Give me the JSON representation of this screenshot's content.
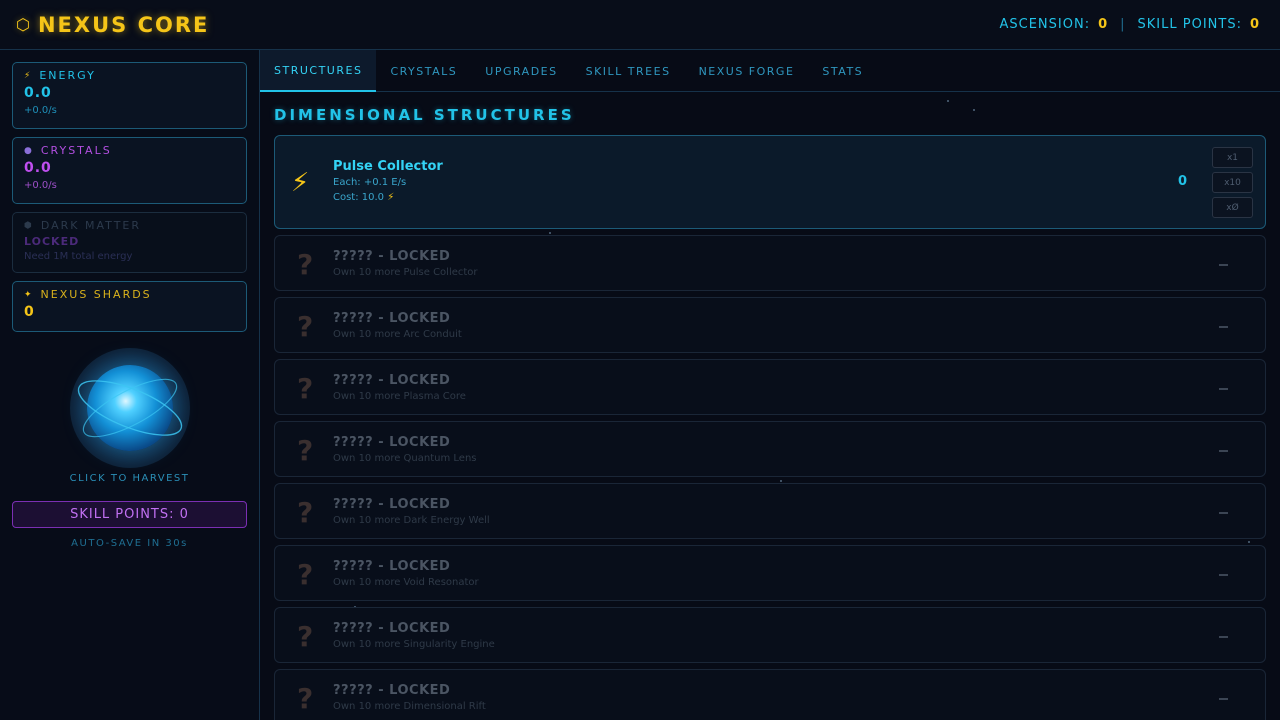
{
  "header": {
    "brand_icon": "hexagon-icon",
    "title": "NEXUS CORE",
    "ascension_label": "ASCENSION:",
    "ascension_value": "0",
    "separator": "|",
    "skill_points_label": "SKILL POINTS:",
    "skill_points_value": "0"
  },
  "resources": {
    "energy": {
      "icon": "lightning-icon",
      "label": "ENERGY",
      "value": "0.0",
      "rate": "+0.0/s",
      "color": "#22c3e8"
    },
    "crystals": {
      "icon": "crystal-icon",
      "label": "CRYSTALS",
      "value": "0.0",
      "rate": "+0.0/s",
      "color": "#c04ff0"
    },
    "dark_matter": {
      "icon": "dark-matter-icon",
      "label": "DARK MATTER",
      "status": "LOCKED",
      "requirement": "Need 1M total energy"
    },
    "nexus_shards": {
      "icon": "sparkle-icon",
      "label": "NEXUS SHARDS",
      "value": "0"
    }
  },
  "orb": {
    "label": "CLICK TO HARVEST"
  },
  "sidebar": {
    "skill_points_button": "SKILL POINTS: 0",
    "autosave": "AUTO-SAVE IN 30s"
  },
  "tabs": [
    {
      "label": "STRUCTURES",
      "active": true
    },
    {
      "label": "CRYSTALS"
    },
    {
      "label": "UPGRADES"
    },
    {
      "label": "SKILL TREES"
    },
    {
      "label": "NEXUS FORGE"
    },
    {
      "label": "STATS"
    }
  ],
  "section": {
    "title": "DIMENSIONAL STRUCTURES"
  },
  "structures": {
    "first": {
      "icon": "lightning-bolt-icon",
      "name": "Pulse Collector",
      "each": "Each: +0.1 E/s",
      "cost": "Cost: 10.0",
      "count": "0",
      "buy_buttons": [
        "x1",
        "x10",
        "xØ"
      ]
    },
    "locked": [
      {
        "name": "????? - LOCKED",
        "requirement": "Own 10 more Pulse Collector"
      },
      {
        "name": "????? - LOCKED",
        "requirement": "Own 10 more Arc Conduit"
      },
      {
        "name": "????? - LOCKED",
        "requirement": "Own 10 more Plasma Core"
      },
      {
        "name": "????? - LOCKED",
        "requirement": "Own 10 more Quantum Lens"
      },
      {
        "name": "????? - LOCKED",
        "requirement": "Own 10 more Dark Energy Well"
      },
      {
        "name": "????? - LOCKED",
        "requirement": "Own 10 more Void Resonator"
      },
      {
        "name": "????? - LOCKED",
        "requirement": "Own 10 more Singularity Engine"
      },
      {
        "name": "????? - LOCKED",
        "requirement": "Own 10 more Dimensional Rift"
      }
    ],
    "locked_icon": "question-mark-icon",
    "locked_marker": "–"
  }
}
